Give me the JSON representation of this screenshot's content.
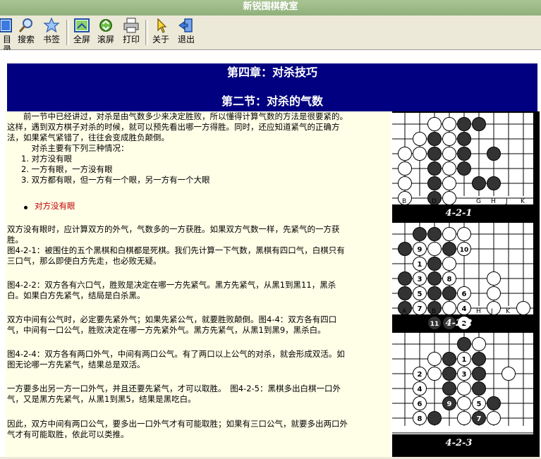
{
  "app": {
    "title": "新锐围棋教室"
  },
  "toolbar": {
    "buttons": [
      {
        "label": "目录",
        "icon": "table-of-contents-icon"
      },
      {
        "label": "搜索",
        "icon": "search-icon"
      },
      {
        "label": "书签",
        "icon": "bookmark-star-icon"
      },
      {
        "label": "全屏",
        "icon": "fullscreen-icon"
      },
      {
        "label": "滚屏",
        "icon": "scroll-icon"
      },
      {
        "label": "打印",
        "icon": "printer-icon"
      },
      {
        "label": "关于",
        "icon": "about-pointer-icon"
      },
      {
        "label": "退出",
        "icon": "exit-door-icon"
      }
    ]
  },
  "page": {
    "chapter_title": "第四章：对杀技巧",
    "section_title": "第二节：对杀的气数"
  },
  "text": {
    "intro_line1": "　　前一节中已经讲过，对杀是由气数多少来决定胜败，所以懂得计算气数的方法是很要紧的。",
    "intro_line2": "这样，遇到双方棋子对杀的时候，就可以预先看出哪一方得胜。同时，还应知道紧气的正确方",
    "intro_line3": "法，如果紧气紧错了，往往会变成胜负颠倒。",
    "cases_intro": "　　　对杀主要有下列三种情况：",
    "cases": [
      "1.  对方没有眼",
      "2.  一方有眼，一方没有眼",
      "3.  双方都有眼，但一方有一个眼，另一方有一个大眼"
    ],
    "link_no_eye": "对方没有眼",
    "p1_l1": "双方没有眼时，应计算双方的外气，气数多的一方获胜。如果双方气数一样，先紧气的一方获",
    "p1_l2": "胜。",
    "p2_l1": "图4-2-1：被围住的五个黑棋和白棋都是死棋。我们先计算一下气数，黑棋有四口气，白棋只有",
    "p2_l2": "三口气，那么即使白方先走，也必败无疑。",
    "p3_l1": "图4-2-2：双方各有六口气，胜败是决定在哪一方先紧气。黑方先紧气，从黑1到黑11，黑杀",
    "p3_l2": "白。如果白方先紧气，结局是白杀黑。",
    "p4_l1": "双方中间有公气时，必定要先紧外气；如果先紧公气，就要胜败颠倒。图4-4：双方各有四口",
    "p4_l2": "气，中间有一口公气，胜败决定在哪一方先紧外气。黑方先紧气，从黑1到黑9，黑杀白。",
    "p5_l1": "图4-2-4：双方各有两口外气，中间有两口公气。有了两口以上公气的对杀，就会形成双活。如",
    "p5_l2": "图无论哪一方先紧气，结果总是双活。",
    "p6_l1": "一方要多出另一方一口外气，并且还要先紧气，才可以取胜。　图4-2-5：黑棋多出白棋一口外",
    "p6_l2": "气，又是黑方先紧气，从黑1到黑5，结果是黑吃白。",
    "p7_l1": "因此，双方中间有两口公气，要多出一口外气才有可能取胜；如果有三口公气，就要多出两口外",
    "p7_l2": "气才有可能取胜，依此可以类推。"
  },
  "figures": [
    {
      "caption": "4-2-1",
      "col_labels": [
        "B",
        "D",
        "G",
        "H",
        "J",
        "K"
      ],
      "stones": [
        {
          "c": "w",
          "col": 3,
          "row": 0
        },
        {
          "c": "w",
          "col": 4,
          "row": 0
        },
        {
          "c": "b",
          "col": 5,
          "row": 0
        },
        {
          "c": "b",
          "col": 6,
          "row": 0
        },
        {
          "c": "w",
          "col": 2,
          "row": 1
        },
        {
          "c": "b",
          "col": 3,
          "row": 1
        },
        {
          "c": "w",
          "col": 4,
          "row": 1
        },
        {
          "c": "b",
          "col": 5,
          "row": 1
        },
        {
          "c": "w",
          "col": 1,
          "row": 2
        },
        {
          "c": "w",
          "col": 2,
          "row": 2
        },
        {
          "c": "b",
          "col": 3,
          "row": 2
        },
        {
          "c": "w",
          "col": 4,
          "row": 2
        },
        {
          "c": "b",
          "col": 5,
          "row": 2
        },
        {
          "c": "b",
          "col": 7,
          "row": 2
        },
        {
          "c": "w",
          "col": 1,
          "row": 3
        },
        {
          "c": "b",
          "col": 3,
          "row": 3
        },
        {
          "c": "w",
          "col": 4,
          "row": 3
        },
        {
          "c": "b",
          "col": 5,
          "row": 3
        },
        {
          "c": "w",
          "col": 1,
          "row": 4
        },
        {
          "c": "b",
          "col": 3,
          "row": 4
        },
        {
          "c": "w",
          "col": 4,
          "row": 4
        },
        {
          "c": "b",
          "col": 6,
          "row": 4
        },
        {
          "c": "b",
          "col": 7,
          "row": 4
        },
        {
          "c": "w",
          "col": 1,
          "row": 5
        },
        {
          "c": "b",
          "col": 3,
          "row": 5
        },
        {
          "c": "w",
          "col": 4,
          "row": 5
        }
      ]
    },
    {
      "caption": "4-2-2",
      "col_labels": [
        "A",
        "B",
        "H",
        "J",
        "K"
      ],
      "stones": [
        {
          "c": "b",
          "col": 2,
          "row": 0
        },
        {
          "c": "b",
          "col": 3,
          "row": 0
        },
        {
          "c": "w",
          "col": 4,
          "row": 0
        },
        {
          "c": "w",
          "col": 5,
          "row": 0
        },
        {
          "c": "b",
          "col": 1,
          "row": 1
        },
        {
          "c": "w",
          "col": 2,
          "row": 1,
          "n": "9"
        },
        {
          "c": "w",
          "col": 3,
          "row": 1
        },
        {
          "c": "b",
          "col": 4,
          "row": 1
        },
        {
          "c": "w",
          "col": 5,
          "row": 1,
          "n": "10"
        },
        {
          "c": "w",
          "col": 2,
          "row": 2,
          "n": "1"
        },
        {
          "c": "b",
          "col": 3,
          "row": 2
        },
        {
          "c": "w",
          "col": 4,
          "row": 2
        },
        {
          "c": "b",
          "col": 1,
          "row": 3
        },
        {
          "c": "w",
          "col": 2,
          "row": 3,
          "n": "3"
        },
        {
          "c": "b",
          "col": 3,
          "row": 3
        },
        {
          "c": "w",
          "col": 4,
          "row": 3,
          "n": "8"
        },
        {
          "c": "w",
          "col": 7,
          "row": 3
        },
        {
          "c": "b",
          "col": 1,
          "row": 4
        },
        {
          "c": "w",
          "col": 2,
          "row": 4,
          "n": "5"
        },
        {
          "c": "b",
          "col": 3,
          "row": 4
        },
        {
          "c": "b",
          "col": 4,
          "row": 4
        },
        {
          "c": "w",
          "col": 5,
          "row": 4,
          "n": "6"
        },
        {
          "c": "w",
          "col": 7,
          "row": 4
        },
        {
          "c": "b",
          "col": 1,
          "row": 5
        },
        {
          "c": "w",
          "col": 2,
          "row": 5,
          "n": "7"
        },
        {
          "c": "b",
          "col": 3,
          "row": 5
        },
        {
          "c": "w",
          "col": 4,
          "row": 5
        },
        {
          "c": "w",
          "col": 5,
          "row": 5,
          "n": "4"
        },
        {
          "c": "w",
          "col": 7,
          "row": 5
        },
        {
          "c": "w",
          "col": 9,
          "row": 5
        },
        {
          "c": "b",
          "col": 3,
          "row": 6,
          "n": "11"
        },
        {
          "c": "b",
          "col": 4,
          "row": 6
        },
        {
          "c": "w",
          "col": 5,
          "row": 6,
          "n": "2"
        }
      ]
    },
    {
      "caption": "4-2-3",
      "col_labels": [],
      "stones": [
        {
          "c": "b",
          "col": 5,
          "row": 0
        },
        {
          "c": "w",
          "col": 6,
          "row": 0
        },
        {
          "c": "w",
          "col": 3,
          "row": 1
        },
        {
          "c": "b",
          "col": 4,
          "row": 1
        },
        {
          "c": "w",
          "col": 5,
          "row": 1,
          "n": "1"
        },
        {
          "c": "b",
          "col": 6,
          "row": 1
        },
        {
          "c": "w",
          "col": 2,
          "row": 2,
          "n": "2"
        },
        {
          "c": "w",
          "col": 3,
          "row": 2
        },
        {
          "c": "b",
          "col": 4,
          "row": 2
        },
        {
          "c": "w",
          "col": 5,
          "row": 2,
          "n": "3"
        },
        {
          "c": "b",
          "col": 6,
          "row": 2
        },
        {
          "c": "w",
          "col": 8,
          "row": 2
        },
        {
          "c": "w",
          "col": 2,
          "row": 3,
          "n": "4"
        },
        {
          "c": "b",
          "col": 4,
          "row": 3
        },
        {
          "c": "w",
          "col": 5,
          "row": 3
        },
        {
          "c": "b",
          "col": 6,
          "row": 3
        },
        {
          "c": "w",
          "col": 2,
          "row": 4,
          "n": "6"
        },
        {
          "c": "b",
          "col": 4,
          "row": 4,
          "n": "9"
        },
        {
          "c": "w",
          "col": 5,
          "row": 4
        },
        {
          "c": "w",
          "col": 6,
          "row": 4,
          "n": "5"
        },
        {
          "c": "b",
          "col": 7,
          "row": 4
        },
        {
          "c": "w",
          "col": 2,
          "row": 5,
          "n": "8"
        },
        {
          "c": "b",
          "col": 3,
          "row": 5
        },
        {
          "c": "w",
          "col": 5,
          "row": 5
        },
        {
          "c": "b",
          "col": 6,
          "row": 5,
          "n": "7"
        },
        {
          "c": "w",
          "col": 7,
          "row": 5
        }
      ]
    }
  ]
}
